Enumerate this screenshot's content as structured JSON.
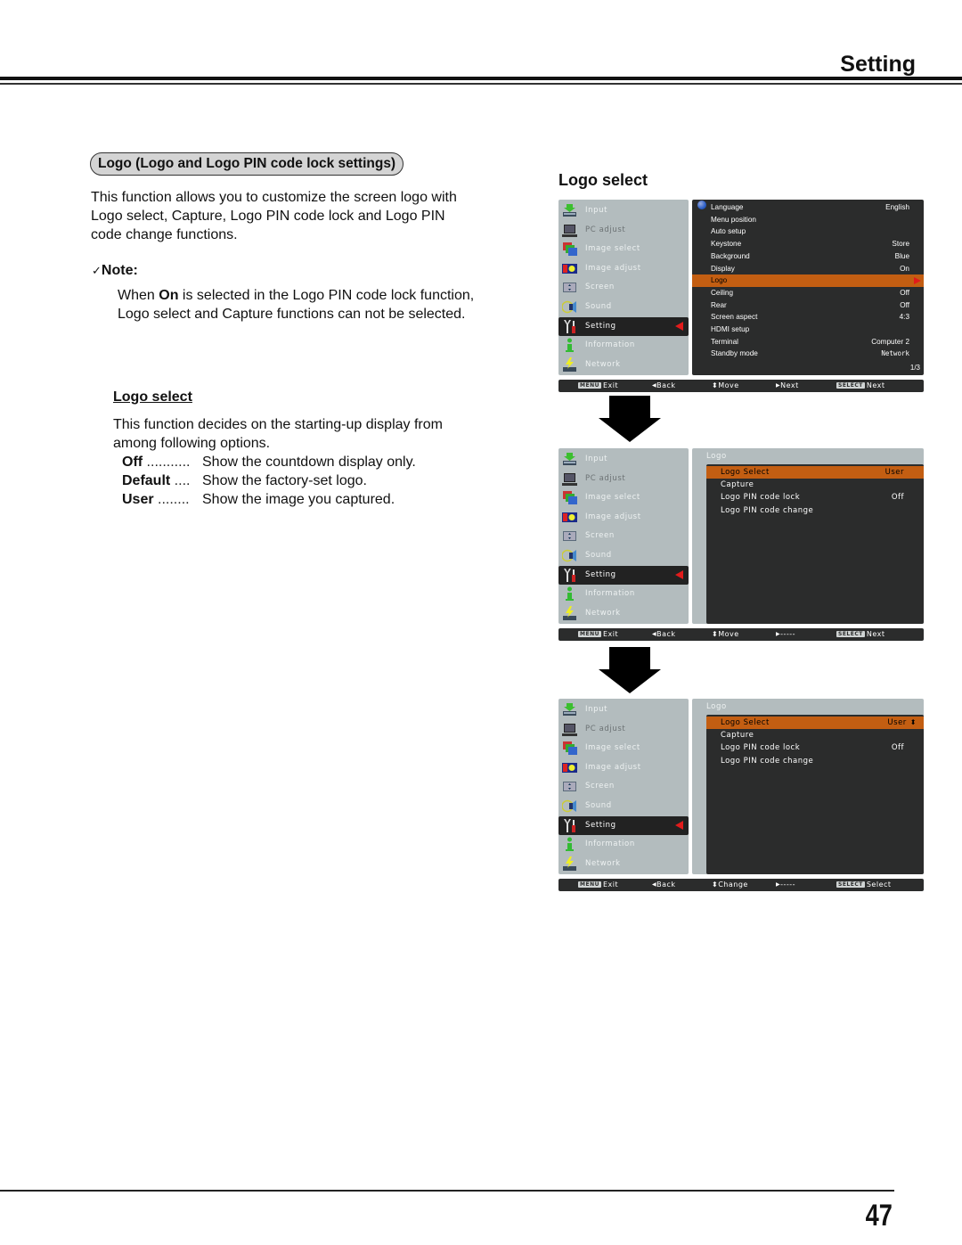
{
  "header": {
    "title": "Setting"
  },
  "left": {
    "section_title": "Logo (Logo and Logo PIN code lock settings)",
    "intro_lines": [
      "This function allows you to customize the screen logo with",
      "Logo select, Capture, Logo PIN code lock and Logo PIN",
      "code change functions."
    ],
    "note": {
      "heading": "Note:",
      "check_icon": "✓",
      "line1_pre": "When ",
      "line1_bold": "On",
      "line1_post": " is selected in the Logo PIN code lock function,",
      "line2": "Logo select and Capture functions can not be selected."
    },
    "logo_select": {
      "heading": "Logo select",
      "desc_lines": [
        "This function decides on the starting-up display from",
        "among following options."
      ],
      "options": [
        {
          "name": "Off",
          "dots": " ...........",
          "desc": "Show the countdown display only."
        },
        {
          "name": "Default",
          "dots": " ....",
          "desc": "Show the factory-set logo."
        },
        {
          "name": "User",
          "dots": " ........",
          "desc": "Show the image you captured."
        }
      ]
    }
  },
  "right": {
    "title": "Logo select",
    "main_menu": [
      {
        "label": "Input",
        "icon": "input-icon"
      },
      {
        "label": "PC adjust",
        "icon": "pc-adjust-icon"
      },
      {
        "label": "Image select",
        "icon": "image-select-icon"
      },
      {
        "label": "Image adjust",
        "icon": "image-adjust-icon"
      },
      {
        "label": "Screen",
        "icon": "screen-icon"
      },
      {
        "label": "Sound",
        "icon": "sound-icon"
      },
      {
        "label": "Setting",
        "icon": "setting-icon",
        "selected": true
      },
      {
        "label": "Information",
        "icon": "information-icon"
      },
      {
        "label": "Network",
        "icon": "network-icon"
      }
    ],
    "screen1": {
      "settings": [
        {
          "label": "Language",
          "value": "English"
        },
        {
          "label": "Menu position",
          "value": ""
        },
        {
          "label": "Auto setup",
          "value": ""
        },
        {
          "label": "Keystone",
          "value": "Store"
        },
        {
          "label": "Background",
          "value": "Blue"
        },
        {
          "label": "Display",
          "value": "On"
        },
        {
          "label": "Logo",
          "value": "",
          "highlighted": true
        },
        {
          "label": "Ceiling",
          "value": "Off"
        },
        {
          "label": "Rear",
          "value": "Off"
        },
        {
          "label": "Screen aspect",
          "value": "4:3"
        },
        {
          "label": "HDMI setup",
          "value": ""
        },
        {
          "label": "Terminal",
          "value": "Computer 2"
        },
        {
          "label": "Standby mode",
          "value": "Network"
        }
      ],
      "page_indicator": "1/3",
      "bar": {
        "menu_key": "MENU",
        "exit": "Exit",
        "back": "Back",
        "move": "Move",
        "right": "Next",
        "select_key": "SELECT",
        "select": "Next"
      }
    },
    "screen2": {
      "submenu_title": "Logo",
      "rows": [
        {
          "label": "Logo Select",
          "value": "User",
          "highlighted": true
        },
        {
          "label": "Capture",
          "value": ""
        },
        {
          "label": "Logo PIN code lock",
          "value": "Off"
        },
        {
          "label": "Logo PIN code change",
          "value": ""
        }
      ],
      "bar": {
        "menu_key": "MENU",
        "exit": "Exit",
        "back": "Back",
        "move": "Move",
        "right": "-----",
        "select_key": "SELECT",
        "select": "Next"
      }
    },
    "screen3": {
      "submenu_title": "Logo",
      "rows": [
        {
          "label": "Logo Select",
          "value": "User",
          "highlighted": true,
          "adjustable": true
        },
        {
          "label": "Capture",
          "value": ""
        },
        {
          "label": "Logo PIN code lock",
          "value": "Off"
        },
        {
          "label": "Logo PIN code change",
          "value": ""
        }
      ],
      "bar": {
        "menu_key": "MENU",
        "exit": "Exit",
        "back": "Back",
        "move": "Change",
        "right": "-----",
        "select_key": "SELECT",
        "select": "Select"
      }
    },
    "glyphs": {
      "back": "◀",
      "move": "⬍",
      "right": "▶",
      "updown": "⬍"
    }
  },
  "footer": {
    "page_number": "47"
  }
}
